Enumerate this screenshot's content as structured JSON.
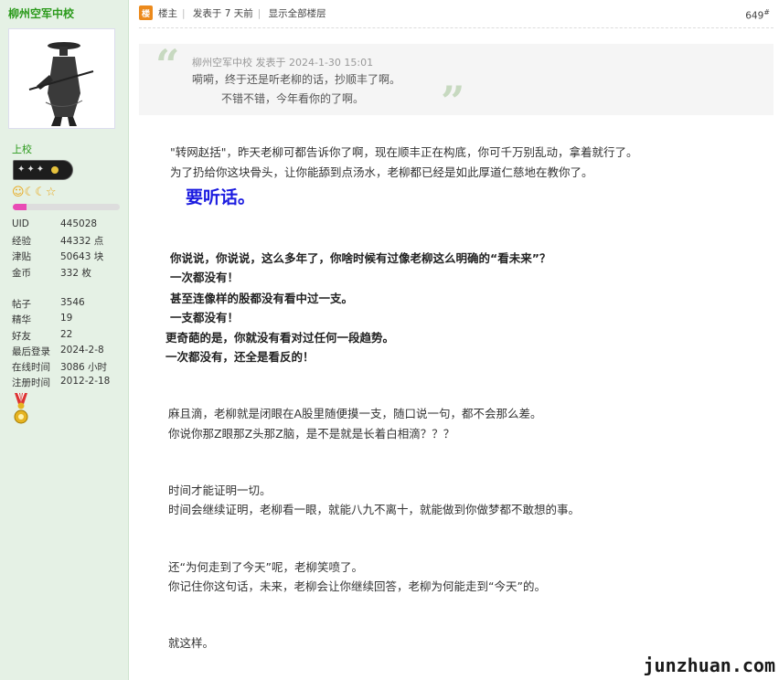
{
  "user": {
    "name": "柳州空军中校",
    "rank": "上校",
    "levels": "☺☾☾☆",
    "exp_progress": 0.13,
    "stats": [
      {
        "k": "UID",
        "v": "445028"
      },
      {
        "k": "经验",
        "v": "44332 点"
      },
      {
        "k": "津贴",
        "v": "50643 块"
      },
      {
        "k": "金币",
        "v": "332 枚"
      },
      {
        "k": "帖子",
        "v": "3546"
      },
      {
        "k": "精华",
        "v": "19"
      },
      {
        "k": "好友",
        "v": "22"
      },
      {
        "k": "最后登录",
        "v": "2024-2-8"
      },
      {
        "k": "在线时间",
        "v": "3086 小时"
      },
      {
        "k": "注册时间",
        "v": "2012-2-18"
      }
    ]
  },
  "header": {
    "owner_label": "楼主",
    "posted": "发表于 7 天前",
    "show_all": "显示全部楼层",
    "post_number": "649",
    "post_number_sup": "#"
  },
  "quote": {
    "meta": "柳州空军中校 发表于 2024-1-30 15:01",
    "line1": "嗬嗬，终于还是听老柳的话，抄顺丰了啊。",
    "line2": "不错不错，今年看你的了啊。"
  },
  "body": {
    "p1a": "\"转网赵括\"，昨天老柳可都告诉你了啊，现在顺丰正在构底，你可千万别乱动，拿着就行了。",
    "p1b": "为了扔给你这块骨头，让你能舔到点汤水，老柳都已经是如此厚道仁慈地在教你了。",
    "emph": "要听话。",
    "b1": "你说说，你说说，这么多年了，你啥时候有过像老柳这么明确的“看未来”？",
    "b2": "一次都没有！",
    "b3": "甚至连像样的股都没有看中过一支。",
    "b4": "一支都没有！",
    "b5": "更奇葩的是，你就没有看对过任何一段趋势。",
    "b6": "一次都没有，还全是看反的！",
    "p3a": "麻且滴，老柳就是闭眼在A股里随便摸一支，随口说一句，都不会那么差。",
    "p3b": "你说你那Z眼那Z头那Z脑，是不是就是长着白相滴？？？",
    "p4a": "时间才能证明一切。",
    "p4b": "时间会继续证明，老柳看一眼，就能八九不离十，就能做到你做梦都不敢想的事。",
    "p5a": "还“为何走到了今天”呢，老柳笑喷了。",
    "p5b": "你记住你这句话，未来，老柳会让你继续回答，老柳为何能走到“今天”的。",
    "p6": "就这样。"
  },
  "watermark": "junzhuan.com",
  "colors": {
    "sidebar_bg": "#e5f1e5",
    "username": "#2b9a1b",
    "emphasis": "#1c1ce0",
    "quote_bg": "#f5f5f5",
    "exp_fill": "#e94bb5"
  }
}
